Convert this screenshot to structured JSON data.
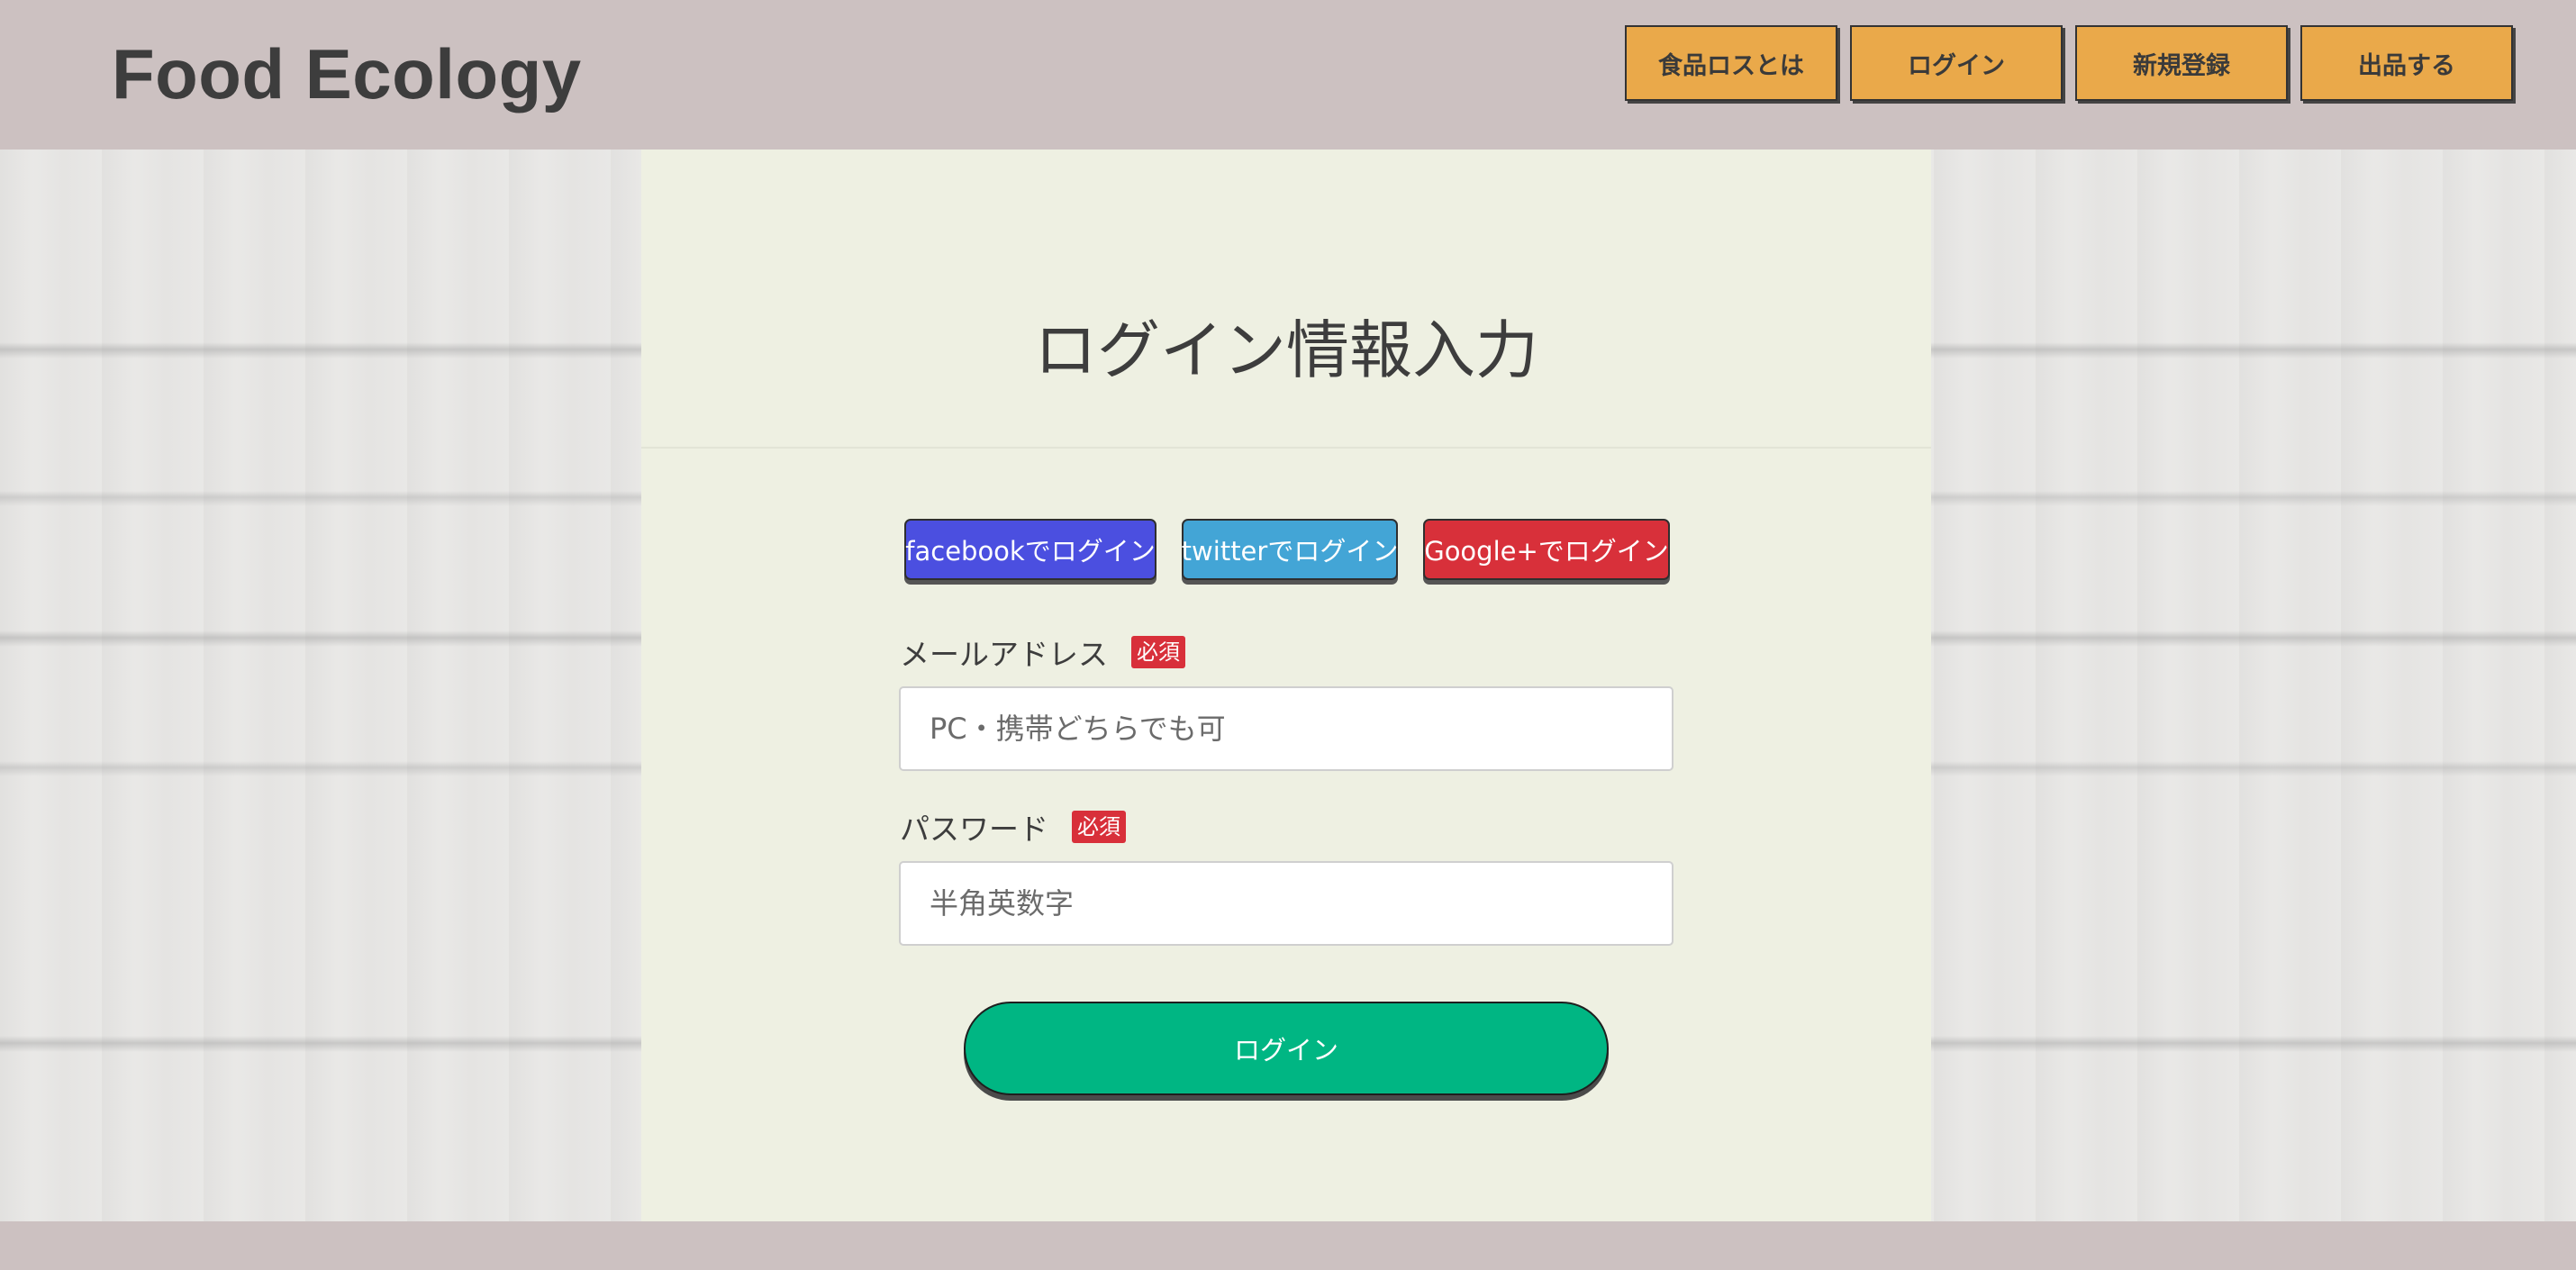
{
  "header": {
    "logo": "Food Ecology",
    "nav": [
      {
        "label": "食品ロスとは"
      },
      {
        "label": "ログイン"
      },
      {
        "label": "新規登録"
      },
      {
        "label": "出品する"
      }
    ]
  },
  "main": {
    "title": "ログイン情報入力",
    "social": {
      "facebook": "facebookでログイン",
      "twitter": "twitterでログイン",
      "google": "Google+でログイン"
    },
    "email": {
      "label": "メールアドレス",
      "badge": "必須",
      "placeholder": "PC・携帯どちらでも可",
      "value": ""
    },
    "password": {
      "label": "パスワード",
      "badge": "必須",
      "placeholder": "半角英数字",
      "value": ""
    },
    "submit_label": "ログイン"
  },
  "colors": {
    "header_bg": "#ccc1c1",
    "nav_button": "#eaa94a",
    "panel_bg": "#eef0e2",
    "facebook": "#4b4fe0",
    "twitter": "#43a5d6",
    "google": "#d8303a",
    "required": "#d8303a",
    "submit": "#00b683"
  }
}
